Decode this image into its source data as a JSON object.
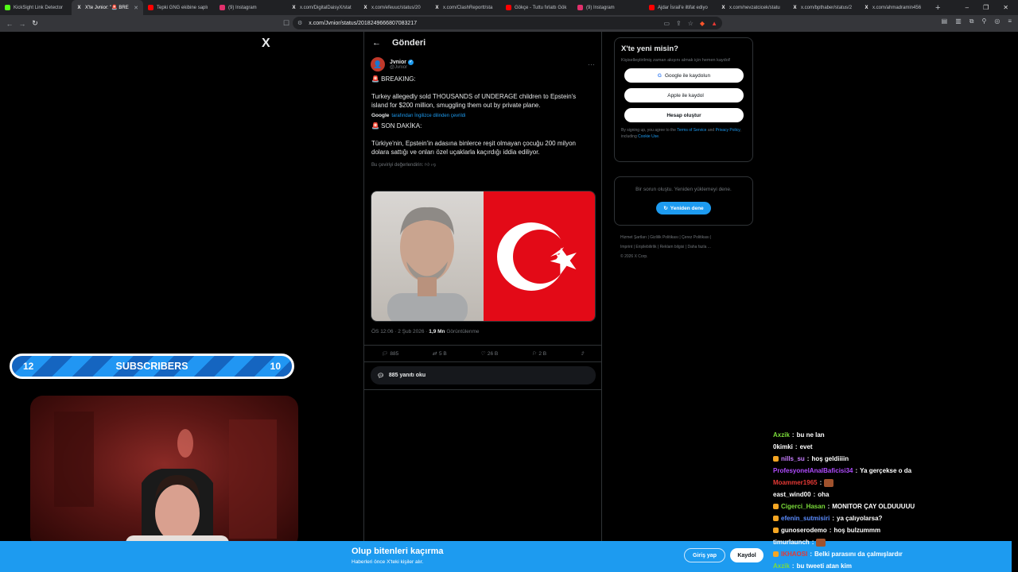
{
  "browser": {
    "tabs": [
      {
        "label": "KickSight Link Detector",
        "icon": "kicksight-icon",
        "color": "#53fc18"
      },
      {
        "label": "X'te Jvnior: \"🚨 BRE",
        "icon": "x-icon",
        "color": "#ffffff",
        "active": true
      },
      {
        "label": "Tepki GNG ekibine saplı",
        "icon": "youtube-icon",
        "color": "#ff0000"
      },
      {
        "label": "(9) Instagram",
        "icon": "instagram-icon",
        "color": "#e1306c"
      },
      {
        "label": "x.com/DigitalDaisyX/stat",
        "icon": "x-icon",
        "color": "#ffffff"
      },
      {
        "label": "x.com/efeuuc/status/20",
        "icon": "x-icon",
        "color": "#ffffff"
      },
      {
        "label": "x.com/ClashReportt/sta",
        "icon": "x-icon",
        "color": "#ffffff"
      },
      {
        "label": "Gökçe - Tuttu fırlattı Gök",
        "icon": "youtube-icon",
        "color": "#ff0000"
      },
      {
        "label": "(9) Instagram",
        "icon": "instagram-icon",
        "color": "#e1306c"
      },
      {
        "label": "Ajdar İsrail'e iltifat ediyo",
        "icon": "youtube-icon",
        "color": "#ff0000"
      },
      {
        "label": "x.com/nevzatcicek/statu",
        "icon": "x-icon",
        "color": "#ffffff"
      },
      {
        "label": "x.com/bpthaber/status/2",
        "icon": "x-icon",
        "color": "#ffffff"
      },
      {
        "label": "x.com/ahmadramin456",
        "icon": "x-icon",
        "color": "#ffffff"
      }
    ],
    "url": "x.com/Jvnior/status/2018249666807083217"
  },
  "x_logo": "X",
  "post": {
    "header": "Gönderi",
    "author_name": "Jvnior",
    "author_handle": "@Jvnior",
    "line1": "🚨 BREAKING:",
    "line2": "Turkey allegedly sold THOUSANDS of UNDERAGE children to Epstein's island for $200 million, smuggling them out by private plane.",
    "translated_by": "Google",
    "translated_note": "tarafından İngilizce dilinden çevrildi",
    "line3": "🚨 SON DAKİKA:",
    "line4": "Türkiye'nin, Epstein'in adasına binlerce reşit olmayan çocuğu 200 milyon dolara sattığı ve onları özel uçaklarla kaçırdığı iddia ediliyor.",
    "rate_translation": "Bu çeviriyi değerlendirin:",
    "timestamp": "ÖS 12:06 · 2 Şub 2026 · ",
    "views_count": "1,9 Mn",
    "views_label": "Görüntülenme",
    "replies": "885",
    "reposts": "5 B",
    "likes": "26 B",
    "bookmarks": "2 B",
    "read_replies": "885 yanıtı oku"
  },
  "signup": {
    "title": "X'te yeni misin?",
    "desc": "Kişiselleştirilmiş zaman akışını almak için hemen kaydol!",
    "google": "Google ile kaydolun",
    "apple": "Apple ile kaydol",
    "create": "Hesap oluştur",
    "terms_pre": "By signing up, you agree to the ",
    "terms_link": "Terms of Service",
    "terms_mid": " and ",
    "privacy_link": "Privacy Policy",
    "terms_mid2": ", including ",
    "cookie_link": "Cookie Use",
    "terms_end": "."
  },
  "error": {
    "message": "Bir sorun oluştu. Yeniden yüklemeyi dene.",
    "retry": "Yeniden dene"
  },
  "footer": {
    "items": [
      "Hizmet Şartları",
      "Gizlilik Politikası",
      "Çerez Politikası",
      "Imprint",
      "Erişilebilirlik",
      "Reklam bilgisi",
      "Daha fazla ..."
    ],
    "copyright": "© 2026 X Corp."
  },
  "overlay": {
    "sub_left": "12",
    "sub_label": "SUBSCRIBERS",
    "sub_right": "10"
  },
  "bottom_banner": {
    "title": "Olup bitenleri kaçırma",
    "subtitle": "Haberleri önce X'teki kişiler alır.",
    "login": "Giriş yap",
    "register": "Kaydol"
  },
  "chat": [
    {
      "user": "Axzik",
      "color": "#7bdc3a",
      "text": "bu ne lan"
    },
    {
      "user": "0kimki",
      "color": "#ffffff",
      "text": "evet"
    },
    {
      "user": "nills_su",
      "color": "#c77dff",
      "text": "hoş geldiiiin",
      "badges": true
    },
    {
      "user": "ProfesyonelAnalBaficisi34",
      "color": "#b04cff",
      "text": "Ya gerçekse o da"
    },
    {
      "user": "Moammer1965",
      "color": "#e53935",
      "text": ""
    },
    {
      "user": "east_wind00",
      "color": "#ffffff",
      "text": "oha"
    },
    {
      "user": "Cigerci_Hasan",
      "color": "#7bdc3a",
      "text": "MONITOR ÇAY OLDUUUUU",
      "badges": true
    },
    {
      "user": "efenin_sutmisiri",
      "color": "#5b8cff",
      "text": "ya çalıyolarsa?",
      "badges": true
    },
    {
      "user": "gunoserodemo",
      "color": "#ffffff",
      "text": "hoş bulzummm",
      "badges": true
    },
    {
      "user": "timurlaunch",
      "color": "#ffffff",
      "text": ""
    },
    {
      "user": "IKHAOSI",
      "color": "#e53935",
      "text": "Belki parasını da çalmışlardır",
      "badges": true
    },
    {
      "user": "Axzik",
      "color": "#7bdc3a",
      "text": "bu tweeti atan kim"
    }
  ]
}
